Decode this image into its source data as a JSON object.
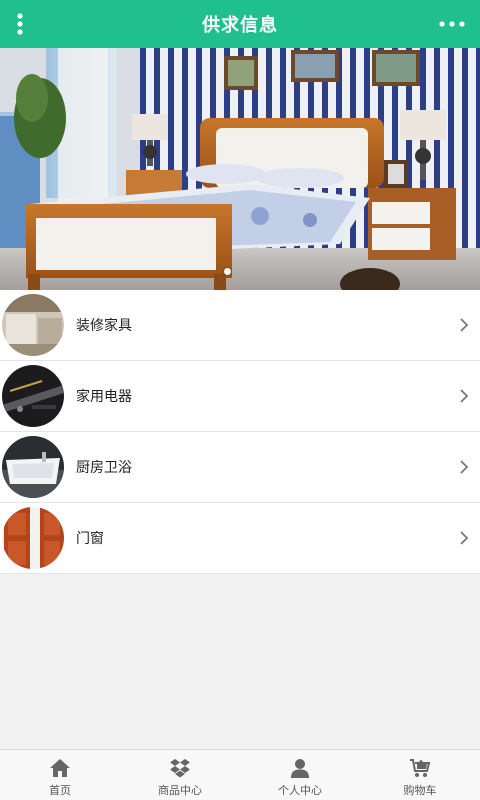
{
  "header": {
    "title": "供求信息",
    "bg_color": "#1fbf8e",
    "menu_icon": "vertical-dots-icon",
    "more_icon": "horizontal-dots-icon"
  },
  "banner": {
    "image": "bedroom-bed-photo",
    "active_slide": 1,
    "slide_count": 1
  },
  "categories": [
    {
      "label": "装修家具",
      "thumb": "furniture-thumb"
    },
    {
      "label": "家用电器",
      "thumb": "appliance-thumb"
    },
    {
      "label": "厨房卫浴",
      "thumb": "bathtub-thumb"
    },
    {
      "label": "门窗",
      "thumb": "door-thumb"
    }
  ],
  "bottom_nav": [
    {
      "label": "首页",
      "icon": "home-icon"
    },
    {
      "label": "商品中心",
      "icon": "dropbox-icon"
    },
    {
      "label": "个人中心",
      "icon": "user-icon"
    },
    {
      "label": "购物车",
      "icon": "cart-icon"
    }
  ]
}
